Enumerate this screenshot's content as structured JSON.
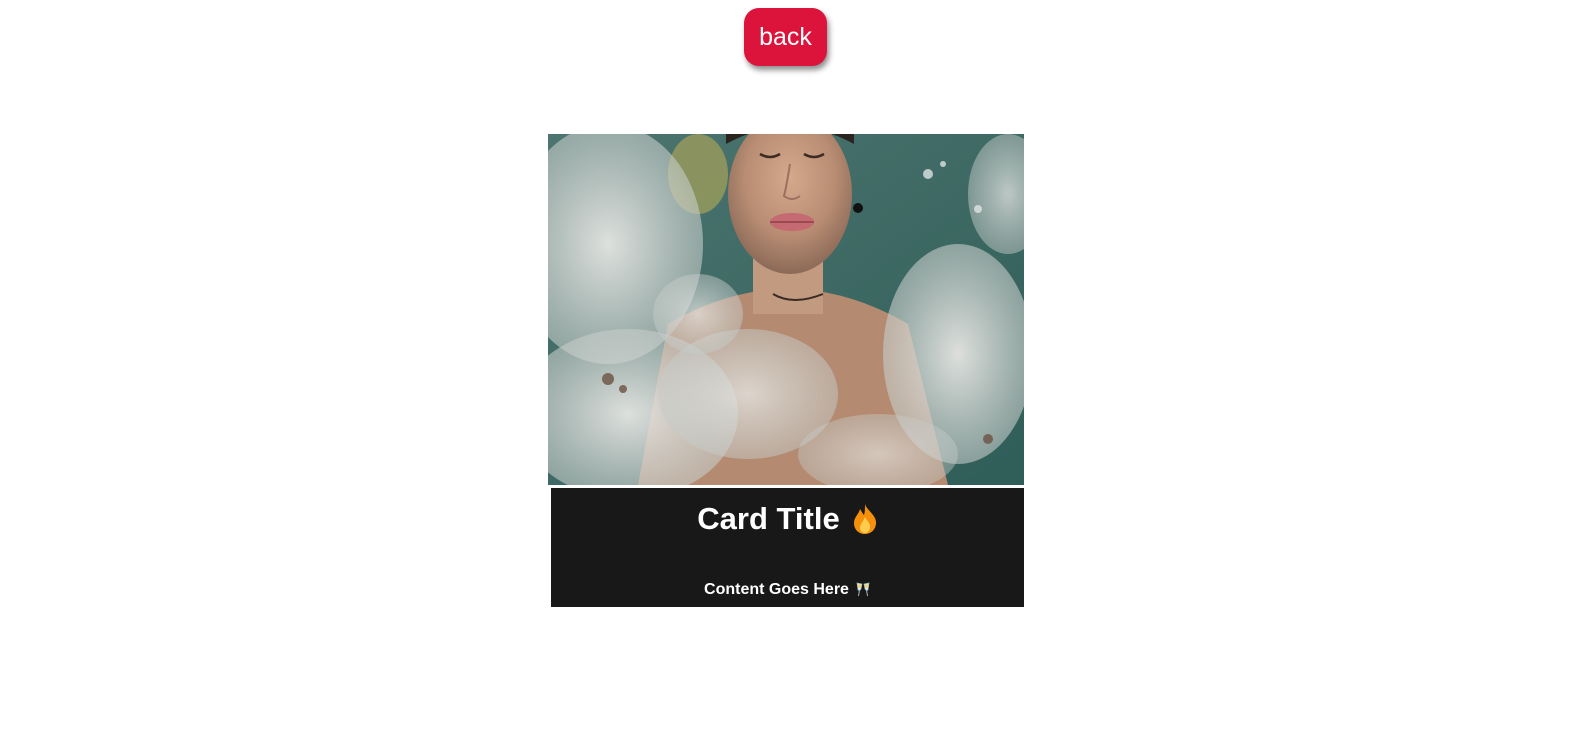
{
  "back_button": {
    "label": "back",
    "color": "#dc143c",
    "icon": "none"
  },
  "card": {
    "image": {
      "subject": "photo"
    },
    "title": "Card Title",
    "title_icon": "flame-icon",
    "content": "Content Goes Here",
    "content_icon": "clinking-glasses-icon",
    "background_color": "#181818",
    "text_color": "#ffffff"
  }
}
